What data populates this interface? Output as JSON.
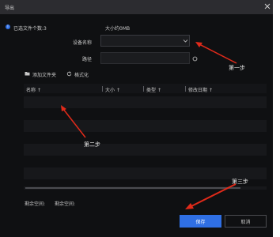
{
  "dialog": {
    "title": "导出"
  },
  "info": {
    "selected_count": "已选文件个数:3",
    "total_size": "大小约0MB"
  },
  "form": {
    "device_label": "设备名称",
    "device_value": "",
    "path_label": "路径",
    "path_value": ""
  },
  "toolbar": {
    "add_folder_label": "添加文件夹",
    "format_label": "格式化"
  },
  "table": {
    "columns": [
      "名称",
      "大小",
      "类型",
      "修改日期"
    ],
    "rows": []
  },
  "footer": {
    "free_space_label": "剩余空间:",
    "free_space_value": "剩余空间:"
  },
  "buttons": {
    "save": "保存",
    "cancel": "取消"
  },
  "annotations": {
    "step1": "第一步",
    "step2": "第二步",
    "step3": "第三步"
  },
  "colors": {
    "accent": "#2f6fe4",
    "background": "#0f1012",
    "titlebar": "#2c2c30",
    "annotation_arrow": "#e02a1a"
  },
  "icons": {
    "info": "info-icon",
    "close": "close-icon",
    "chevron": "chevron-down-icon",
    "refresh": "refresh-icon",
    "folder": "folder-icon",
    "format": "format-icon",
    "sort": "sort-icon"
  }
}
